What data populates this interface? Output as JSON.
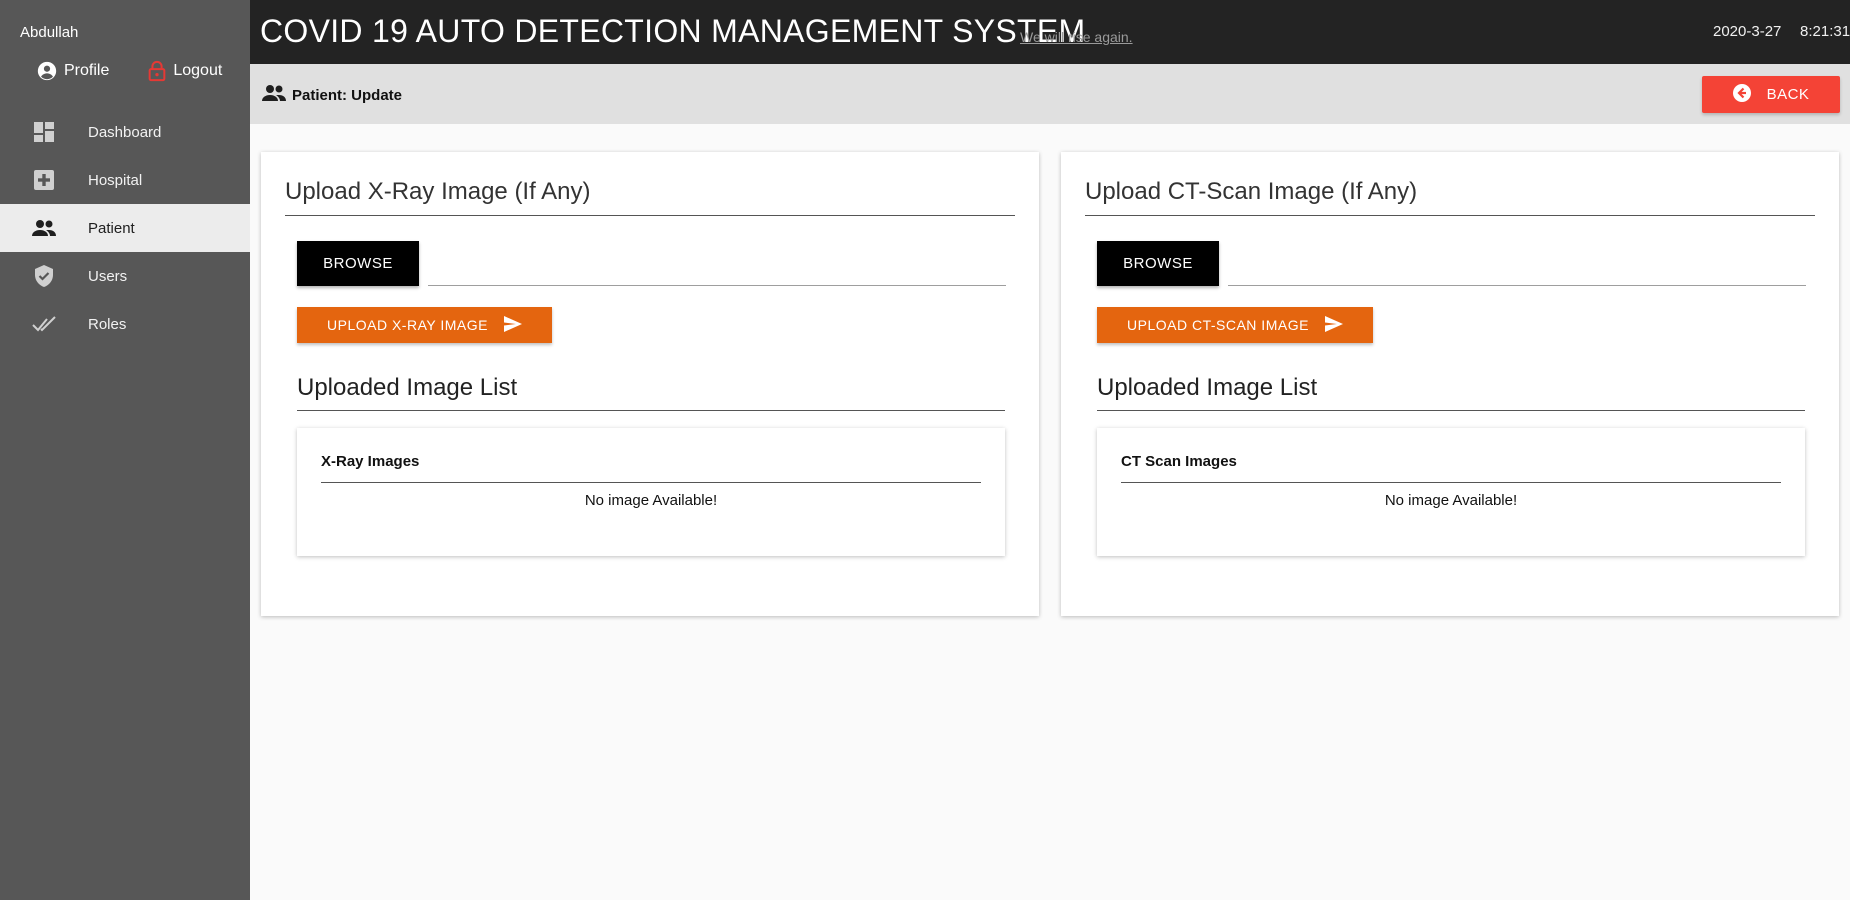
{
  "sidebar": {
    "user_name": "Abdullah",
    "profile_label": "Profile",
    "logout_label": "Logout",
    "items": [
      {
        "label": "Dashboard",
        "icon": "dashboard-icon"
      },
      {
        "label": "Hospital",
        "icon": "hospital-plus-icon"
      },
      {
        "label": "Patient",
        "icon": "people-icon",
        "active": true
      },
      {
        "label": "Users",
        "icon": "shield-check-icon"
      },
      {
        "label": "Roles",
        "icon": "double-check-icon"
      }
    ]
  },
  "header": {
    "title": "COVID 19 AUTO DETECTION MANAGEMENT SYSTEM",
    "tagline": "We will rise again.",
    "date": "2020-3-27",
    "time": "8:21:31"
  },
  "subheader": {
    "breadcrumb": "Patient: Update",
    "back_label": "BACK"
  },
  "xray": {
    "title": "Upload X-Ray Image (If Any)",
    "browse_label": "BROWSE",
    "file_value": "",
    "upload_label": "UPLOAD X-RAY IMAGE",
    "list_title": "Uploaded Image List",
    "list_header": "X-Ray Images",
    "empty_text": "No image Available!"
  },
  "ctscan": {
    "title": "Upload CT-Scan Image (If Any)",
    "browse_label": "BROWSE",
    "file_value": "",
    "upload_label": "UPLOAD CT-SCAN IMAGE",
    "list_title": "Uploaded Image List",
    "list_header": "CT Scan Images",
    "empty_text": "No image Available!"
  },
  "colors": {
    "sidebar": "#575757",
    "topbar": "#232323",
    "accent_orange": "#e4650f",
    "back_red": "#f44336",
    "logout_icon_red": "#e53935"
  }
}
